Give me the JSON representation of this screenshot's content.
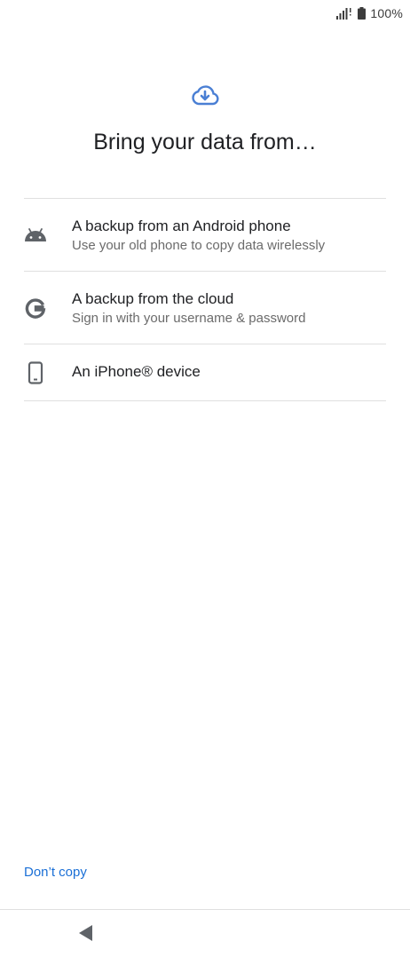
{
  "status_bar": {
    "battery_text": "100%",
    "icons": [
      "signal-icon",
      "battery-icon"
    ]
  },
  "header": {
    "icon": "cloud-download-icon",
    "title": "Bring your data from…"
  },
  "options": [
    {
      "icon": "android-icon",
      "title": "A backup from an Android phone",
      "subtitle": "Use your old phone to copy data wirelessly"
    },
    {
      "icon": "google-icon",
      "title": "A backup from the cloud",
      "subtitle": "Sign in with your username & password"
    },
    {
      "icon": "phone-icon",
      "title": "An iPhone® device"
    }
  ],
  "footer": {
    "dont_copy_label": "Don’t copy"
  },
  "nav": {
    "icons": [
      "back-icon"
    ]
  },
  "colors": {
    "accent": "#1a6fd6",
    "cloud_icon": "#4a7fd4",
    "icon_gray": "#5f6368",
    "divider": "#e0e0e0"
  }
}
